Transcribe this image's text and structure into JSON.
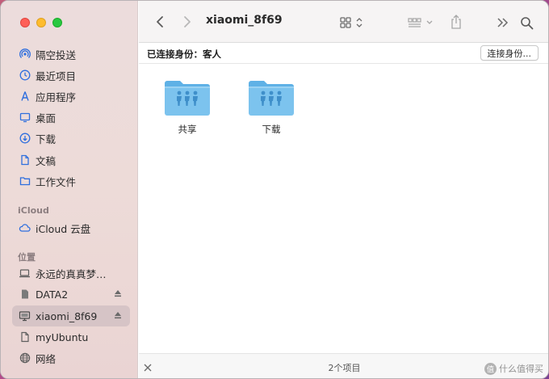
{
  "window": {
    "title": "xiaomi_8f69"
  },
  "sidebar": {
    "sections": [
      {
        "label": "",
        "items": [
          {
            "label": "隔空投送",
            "icon": "airdrop-icon"
          },
          {
            "label": "最近项目",
            "icon": "clock-icon"
          },
          {
            "label": "应用程序",
            "icon": "applications-icon"
          },
          {
            "label": "桌面",
            "icon": "desktop-icon"
          },
          {
            "label": "下载",
            "icon": "download-icon"
          },
          {
            "label": "文稿",
            "icon": "document-icon"
          },
          {
            "label": "工作文件",
            "icon": "folder-icon"
          }
        ]
      },
      {
        "label": "iCloud",
        "items": [
          {
            "label": "iCloud 云盘",
            "icon": "cloud-icon"
          }
        ]
      },
      {
        "label": "位置",
        "items": [
          {
            "label": "永远的真真梦的 ...",
            "icon": "laptop-icon"
          },
          {
            "label": "DATA2",
            "icon": "drive-icon",
            "ejectable": true
          },
          {
            "label": "xiaomi_8f69",
            "icon": "server-icon",
            "ejectable": true,
            "selected": true
          },
          {
            "label": "myUbuntu",
            "icon": "file-icon"
          },
          {
            "label": "网络",
            "icon": "globe-icon"
          }
        ]
      }
    ]
  },
  "connection": {
    "status": "已连接身份：客人",
    "button_label": "连接身份..."
  },
  "files": [
    {
      "name": "共享",
      "icon": "shared-folder-icon"
    },
    {
      "name": "下载",
      "icon": "shared-folder-icon"
    }
  ],
  "statusbar": {
    "item_count": "2个项目"
  },
  "watermark": {
    "badge": "值",
    "text": "什么值得买"
  },
  "colors": {
    "accent": "#2f6fde",
    "folder": "#7cc3ee",
    "selection": "#d6c4c6"
  }
}
